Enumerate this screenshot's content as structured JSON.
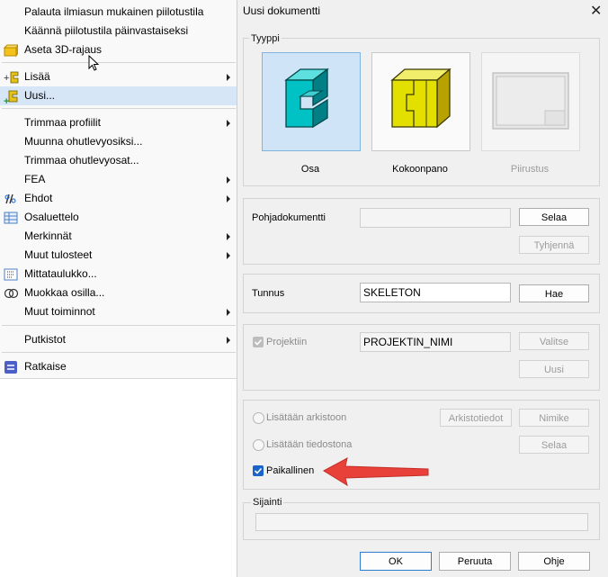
{
  "menu": {
    "items": [
      {
        "label": "Palauta ilmiasun mukainen piilotustila"
      },
      {
        "label": "Käännä piilotustila päinvastaiseksi"
      },
      {
        "label": "Aseta 3D-rajaus"
      },
      {
        "label": "Lisää"
      },
      {
        "label": "Uusi..."
      },
      {
        "label": "Trimmaa profiilit"
      },
      {
        "label": "Muunna ohutlevyosiksi..."
      },
      {
        "label": "Trimmaa ohutlevyosat..."
      },
      {
        "label": "FEA"
      },
      {
        "label": "Ehdot"
      },
      {
        "label": "Osaluettelo"
      },
      {
        "label": "Merkinnät"
      },
      {
        "label": "Muut tulosteet"
      },
      {
        "label": "Mittataulukko..."
      },
      {
        "label": "Muokkaa osilla..."
      },
      {
        "label": "Muut toiminnot"
      },
      {
        "label": "Putkistot"
      },
      {
        "label": "Ratkaise"
      }
    ]
  },
  "dialog": {
    "title": "Uusi dokumentti",
    "close_glyph": "✕",
    "type_group": {
      "title": "Tyyppi",
      "tiles": [
        {
          "label": "Osa"
        },
        {
          "label": "Kokoonpano"
        },
        {
          "label": "Piirustus"
        }
      ]
    },
    "template": {
      "label": "Pohjadokumentti",
      "value": "",
      "browse": "Selaa",
      "clear": "Tyhjennä"
    },
    "id": {
      "label": "Tunnus",
      "value": "SKELETON",
      "fetch": "Hae"
    },
    "project": {
      "label": "Projektiin",
      "value": "PROJEKTIN_NIMI",
      "select": "Valitse",
      "new": "Uusi"
    },
    "storage": {
      "archive_label": "Lisätään arkistoon",
      "archive_info": "Arkistotiedot",
      "name_btn": "Nimike",
      "file_label": "Lisätään tiedostona",
      "file_browse": "Selaa",
      "local_label": "Paikallinen"
    },
    "location": {
      "label": "Sijainti",
      "value": ""
    },
    "buttons": {
      "ok": "OK",
      "cancel": "Peruuta",
      "help": "Ohje"
    }
  },
  "colors": {
    "accent": "#1a63c9",
    "highlight": "#d6e6f7",
    "tile_selected": "#cfe4f7",
    "annotation_arrow": "#e8413a"
  }
}
